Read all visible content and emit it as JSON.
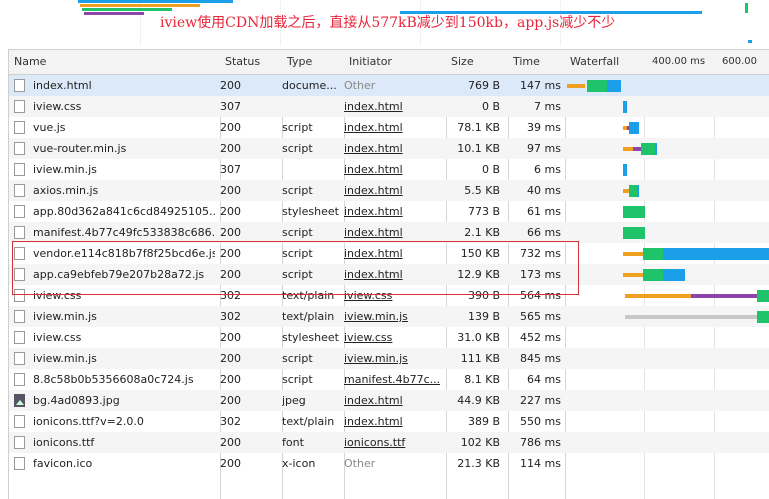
{
  "annotation": "iview使用CDN加载之后，直接从577kB减少到150kb，app.js减少不少",
  "columns": {
    "name": "Name",
    "status": "Status",
    "type": "Type",
    "initiator": "Initiator",
    "size": "Size",
    "time": "Time",
    "waterfall": "Waterfall"
  },
  "waterfall_ticks": [
    "400.00 ms",
    "600.00 ms"
  ],
  "colors": {
    "queue": "#f0a020",
    "stalled": "#c8c8c8",
    "ttfb": "#1fc46a",
    "download": "#1a9fe8",
    "script": "#8e44ad",
    "highlight": "#d9303a",
    "annotation": "#e8263a"
  },
  "requests": [
    {
      "name": "index.html",
      "status": "200",
      "type": "docume...",
      "initiator": "Other",
      "size": "769 B",
      "time": "147 ms",
      "icon": "document-icon"
    },
    {
      "name": "iview.css",
      "status": "307",
      "type": "",
      "initiator": "index.html",
      "size": "0 B",
      "time": "7 ms",
      "icon": "document-icon"
    },
    {
      "name": "vue.js",
      "status": "200",
      "type": "script",
      "initiator": "index.html",
      "size": "78.1 KB",
      "time": "39 ms",
      "icon": "document-icon"
    },
    {
      "name": "vue-router.min.js",
      "status": "200",
      "type": "script",
      "initiator": "index.html",
      "size": "10.1 KB",
      "time": "97 ms",
      "icon": "document-icon"
    },
    {
      "name": "iview.min.js",
      "status": "307",
      "type": "",
      "initiator": "index.html",
      "size": "0 B",
      "time": "6 ms",
      "icon": "document-icon"
    },
    {
      "name": "axios.min.js",
      "status": "200",
      "type": "script",
      "initiator": "index.html",
      "size": "5.5 KB",
      "time": "40 ms",
      "icon": "document-icon"
    },
    {
      "name": "app.80d362a841c6cd84925105...",
      "status": "200",
      "type": "stylesheet",
      "initiator": "index.html",
      "size": "773 B",
      "time": "61 ms",
      "icon": "document-icon"
    },
    {
      "name": "manifest.4b77c49fc533838c686...",
      "status": "200",
      "type": "script",
      "initiator": "index.html",
      "size": "2.1 KB",
      "time": "66 ms",
      "icon": "document-icon"
    },
    {
      "name": "vendor.e114c818b7f8f25bcd6e.js",
      "status": "200",
      "type": "script",
      "initiator": "index.html",
      "size": "150 KB",
      "time": "732 ms",
      "icon": "document-icon"
    },
    {
      "name": "app.ca9ebfeb79e207b28a72.js",
      "status": "200",
      "type": "script",
      "initiator": "index.html",
      "size": "12.9 KB",
      "time": "173 ms",
      "icon": "document-icon"
    },
    {
      "name": "iview.css",
      "status": "302",
      "type": "text/plain",
      "initiator": "iview.css",
      "size": "390 B",
      "time": "564 ms",
      "icon": "document-icon"
    },
    {
      "name": "iview.min.js",
      "status": "302",
      "type": "text/plain",
      "initiator": "iview.min.js",
      "size": "139 B",
      "time": "565 ms",
      "icon": "document-icon"
    },
    {
      "name": "iview.css",
      "status": "200",
      "type": "stylesheet",
      "initiator": "iview.css",
      "size": "31.0 KB",
      "time": "452 ms",
      "icon": "document-icon"
    },
    {
      "name": "iview.min.js",
      "status": "200",
      "type": "script",
      "initiator": "iview.min.js",
      "size": "111 KB",
      "time": "845 ms",
      "icon": "document-icon"
    },
    {
      "name": "8.8c58b0b5356608a0c724.js",
      "status": "200",
      "type": "script",
      "initiator": "manifest.4b77c...",
      "size": "8.1 KB",
      "time": "64 ms",
      "icon": "document-icon"
    },
    {
      "name": "bg.4ad0893.jpg",
      "status": "200",
      "type": "jpeg",
      "initiator": "index.html",
      "size": "44.9 KB",
      "time": "227 ms",
      "icon": "image-icon"
    },
    {
      "name": "ionicons.ttf?v=2.0.0",
      "status": "302",
      "type": "text/plain",
      "initiator": "index.html",
      "size": "389 B",
      "time": "550 ms",
      "icon": "document-icon"
    },
    {
      "name": "ionicons.ttf",
      "status": "200",
      "type": "font",
      "initiator": "ionicons.ttf",
      "size": "102 KB",
      "time": "786 ms",
      "icon": "document-icon"
    },
    {
      "name": "favicon.ico",
      "status": "200",
      "type": "x-icon",
      "initiator": "Other",
      "size": "21.3 KB",
      "time": "114 ms",
      "icon": "document-icon"
    }
  ]
}
